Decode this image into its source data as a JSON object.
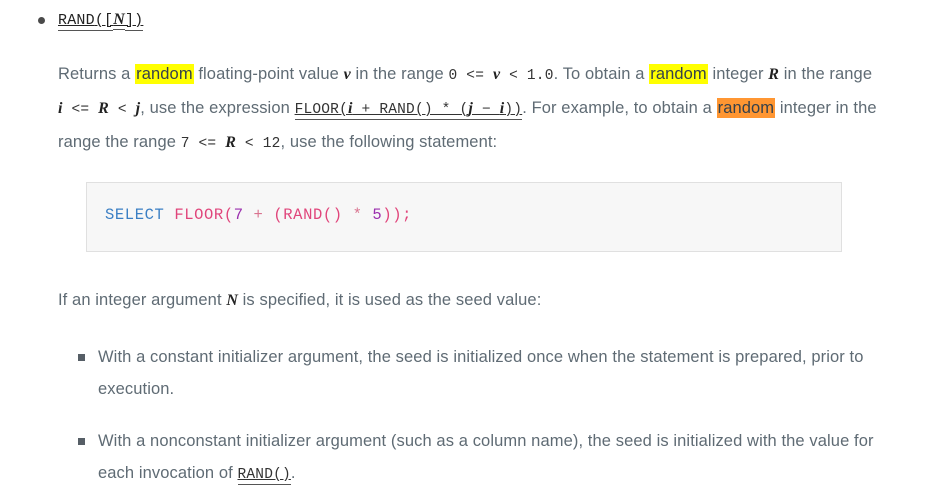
{
  "doc": {
    "function_entry": {
      "name_prefix": "RAND",
      "name_args": "([",
      "name_var": "N",
      "name_suffix": "])"
    },
    "paragraph_1": {
      "s1": "Returns a ",
      "hl1": "random",
      "s2": " floating-point value ",
      "var1": "v",
      "s3": " in the range ",
      "code1": "0 <= ",
      "var2": "v",
      "code2": " < 1.0",
      "s4": ". To obtain a ",
      "hl2": "random",
      "s5": " integer ",
      "var3": "R",
      "s6": " in the range ",
      "code3": "i",
      "code4": " <= ",
      "code5": "R",
      "code6": " < ",
      "code7": "j",
      "s7": ", use the expression ",
      "link_a": "FLOOR(",
      "link_var1": "i",
      "link_b": " + RAND() * (",
      "link_var2": "j",
      "link_c": " − ",
      "link_var3": "i",
      "link_d": "))",
      "s8": ". For example, to obtain a ",
      "hl3": "random",
      "s9": " integer in the range the range ",
      "code8": "7 <= ",
      "var4": "R",
      "code9": " < 12",
      "s10": ", use the following statement:"
    },
    "code_block": {
      "kw_select": "SELECT",
      "fn_floor": "FLOOR",
      "paren_open": "(",
      "num_7": "7",
      "op_plus": " + ",
      "paren_open2": "(",
      "fn_rand": "RAND",
      "rand_parens": "()",
      "op_star": " * ",
      "num_5": "5",
      "tail": "));"
    },
    "paragraph_2": {
      "s1": "If an integer argument ",
      "var1": "N",
      "s2": " is specified, it is used as the seed value:"
    },
    "bullets": [
      {
        "text": "With a constant initializer argument, the seed is initialized once when the statement is prepared, prior to execution."
      },
      {
        "s1": "With a nonconstant initializer argument (such as a column name), the seed is initialized with the value for each invocation of ",
        "link": "RAND()",
        "s2": "."
      }
    ],
    "icons": {
      "round_bullet": "round-bullet-icon",
      "square_bullet": "square-bullet-icon"
    },
    "colors": {
      "text": "#5f6b74",
      "highlight_inactive": "#ffff00",
      "highlight_active": "#ff9632",
      "code_bg": "#f7f7f7",
      "code_border": "#e0e0e0",
      "sql_keyword": "#3b7fc4",
      "sql_function": "#e0457b",
      "sql_number": "#9b2fae"
    }
  }
}
